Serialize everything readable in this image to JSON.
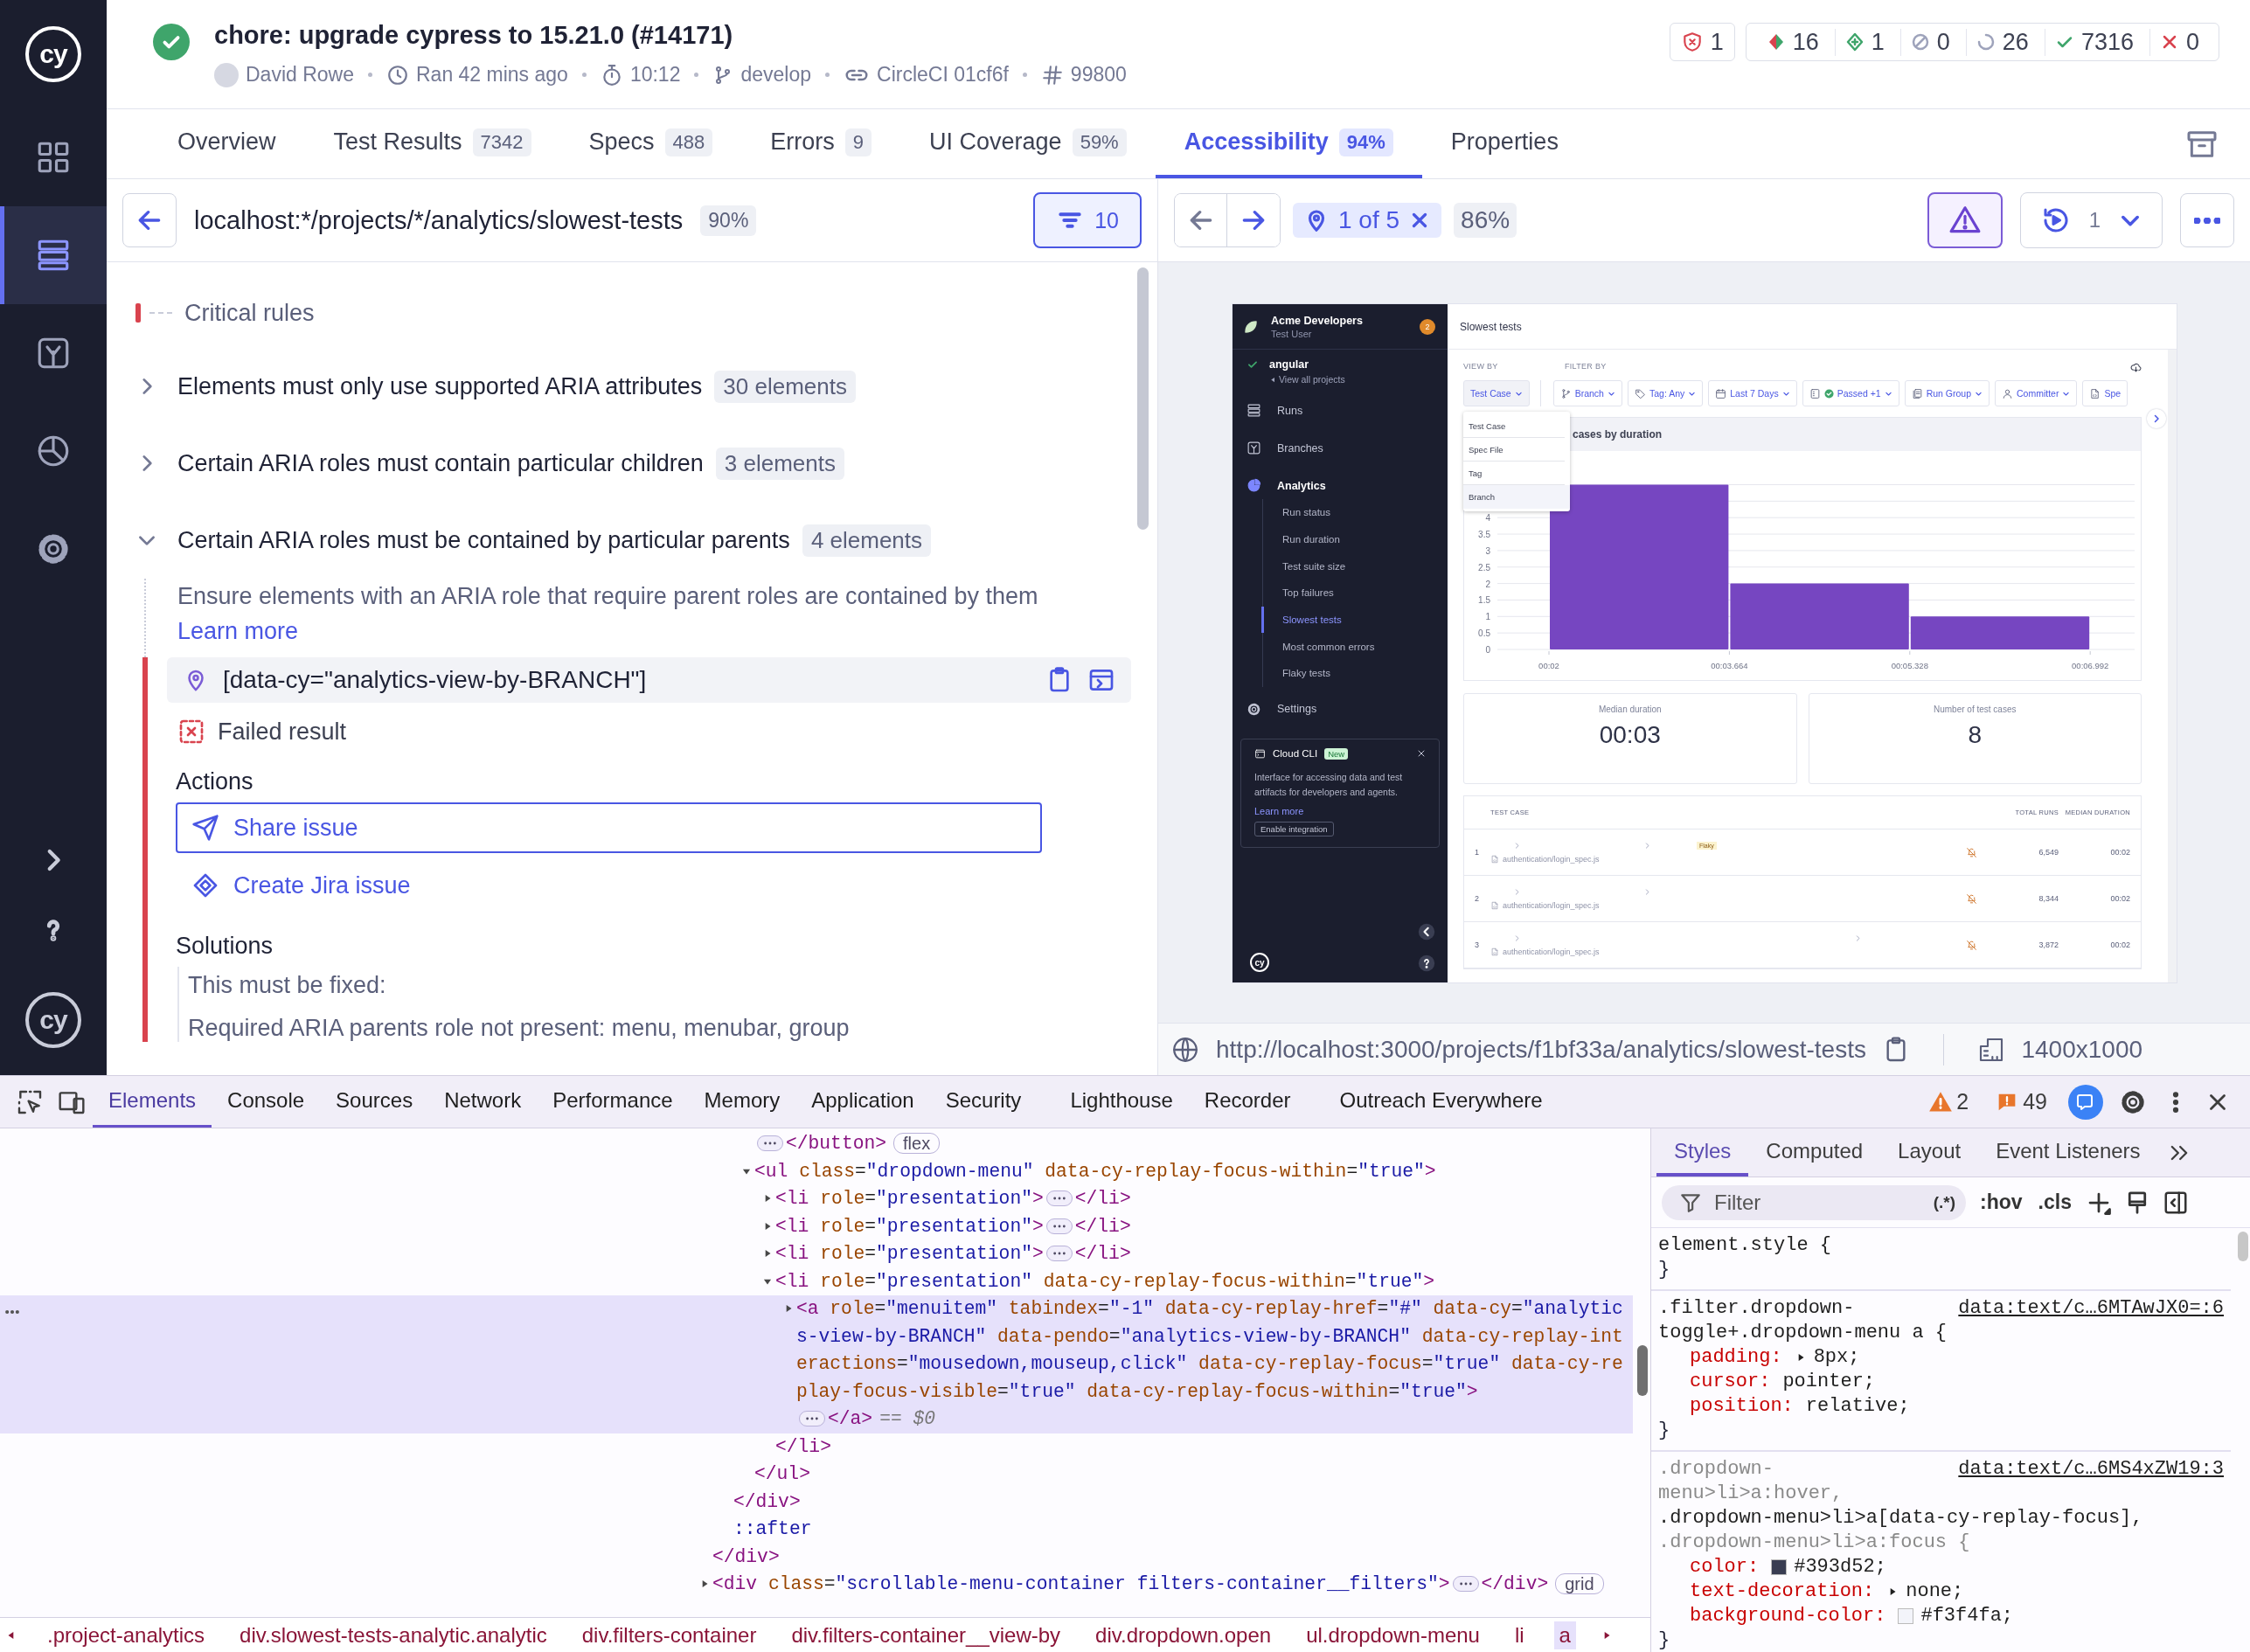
{
  "nav": {
    "logo": "cy",
    "items": [
      {
        "selected": false
      },
      {
        "selected": true
      },
      {
        "selected": false
      },
      {
        "selected": false
      },
      {
        "selected": false
      }
    ],
    "footer_logo": "cy"
  },
  "run": {
    "title": "chore: upgrade cypress to 15.21.0 (#14171)",
    "author": "David Rowe",
    "ran": "Ran 42 mins ago",
    "duration": "10:12",
    "branch": "develop",
    "ci": "CircleCI 01cf6f",
    "number": "99800"
  },
  "flags": {
    "accessibility": "1",
    "counts": [
      {
        "kind": "flaky",
        "value": "16"
      },
      {
        "kind": "new",
        "value": "1"
      },
      {
        "kind": "skipped",
        "value": "0"
      },
      {
        "kind": "pending",
        "value": "26"
      },
      {
        "kind": "passed",
        "value": "7316"
      },
      {
        "kind": "failed",
        "value": "0"
      }
    ]
  },
  "tabs": [
    {
      "label": "Overview",
      "selected": false
    },
    {
      "label": "Test Results",
      "count": "7342",
      "selected": false
    },
    {
      "label": "Specs",
      "count": "488",
      "selected": false
    },
    {
      "label": "Errors",
      "count": "9",
      "selected": false
    },
    {
      "label": "UI Coverage",
      "count": "59%",
      "selected": false
    },
    {
      "label": "Accessibility",
      "count": "94%",
      "selected": true
    },
    {
      "label": "Properties",
      "selected": false
    }
  ],
  "accessibility": {
    "url": "localhost:*/projects/*/analytics/slowest-tests",
    "score": "90%",
    "filter_count": "10",
    "section": "Critical rules",
    "rules": [
      {
        "title": "Elements must only use supported ARIA attributes",
        "count": "30 elements",
        "expanded": false
      },
      {
        "title": "Certain ARIA roles must contain particular children",
        "count": "3 elements",
        "expanded": false
      },
      {
        "title": "Certain ARIA roles must be contained by particular parents",
        "count": "4 elements",
        "expanded": true,
        "description": "Ensure elements with an ARIA role that require parent roles are contained by them",
        "link": "Learn more",
        "selector": "[data-cy=\"analytics-view-by-BRANCH\"]",
        "result": "Failed result",
        "actions_label": "Actions",
        "actions": [
          {
            "label": "Share issue",
            "focused": true
          },
          {
            "label": "Create Jira issue",
            "focused": false
          }
        ],
        "solutions_label": "Solutions",
        "solutions": [
          "This must be fixed:",
          "Required ARIA parents role not present: menu, menubar, group"
        ]
      }
    ]
  },
  "preview": {
    "position": "1 of 5",
    "score": "86%",
    "replay_count": "1",
    "url": "http://localhost:3000/projects/f1bf33a/analytics/slowest-tests",
    "viewport": "1400x1000",
    "app": {
      "org": "Acme Developers",
      "user": "Test User",
      "notifications": "2",
      "project": "angular",
      "back_link": "View all projects",
      "nav": [
        {
          "label": "Runs",
          "selected": false
        },
        {
          "label": "Branches",
          "selected": false
        },
        {
          "label": "Analytics",
          "selected": true,
          "children": [
            {
              "label": "Run status",
              "selected": false
            },
            {
              "label": "Run duration",
              "selected": false
            },
            {
              "label": "Test suite size",
              "selected": false
            },
            {
              "label": "Top failures",
              "selected": false
            },
            {
              "label": "Slowest tests",
              "selected": true
            },
            {
              "label": "Most common errors",
              "selected": false
            },
            {
              "label": "Flaky tests",
              "selected": false
            }
          ]
        },
        {
          "label": "Settings",
          "selected": false
        }
      ],
      "promo": {
        "title": "Cloud CLI",
        "badge": "New",
        "text": "Interface for accessing data and test artifacts for developers and agents.",
        "link": "Learn more",
        "button": "Enable integration"
      },
      "logo": "cy",
      "page_title": "Slowest tests",
      "view_by": {
        "label": "VIEW BY",
        "value": "Test Case",
        "options": [
          {
            "label": "Test Case",
            "highlighted": false
          },
          {
            "label": "Spec File",
            "highlighted": false
          },
          {
            "label": "Tag",
            "highlighted": false
          },
          {
            "label": "Branch",
            "highlighted": true
          }
        ]
      },
      "filter_label": "FILTER BY",
      "filters": [
        "Branch",
        "Tag: Any",
        "Last 7 Days",
        "Passed +1",
        "Run Group",
        "Committer",
        "Spe"
      ],
      "chart_data": {
        "type": "bar",
        "title": "cases by duration",
        "categories": [
          "00:02",
          "00:03.664",
          "00:05.328",
          "00:06.992"
        ],
        "yticks": [
          0,
          0.5,
          1,
          1.5,
          2,
          2.5,
          3,
          3.5,
          4
        ],
        "ylim": [
          0,
          5
        ],
        "grid": true,
        "values": [
          5,
          2,
          1,
          null
        ]
      },
      "metrics": [
        {
          "label": "Median duration",
          "value": "00:03"
        },
        {
          "label": "Number of test cases",
          "value": "8"
        }
      ],
      "table": {
        "columns": [
          "TEST CASE",
          "TOTAL RUNS",
          "MEDIAN DURATION"
        ],
        "rows": [
          {
            "index": "1",
            "spec": "authentication/login_spec.js",
            "tag": "Flaky",
            "total_runs": "6,549",
            "median": "00:02"
          },
          {
            "index": "2",
            "spec": "authentication/login_spec.js",
            "total_runs": "8,344",
            "median": "00:02"
          },
          {
            "index": "3",
            "spec": "authentication/login_spec.js",
            "total_runs": "3,872",
            "median": "00:02"
          }
        ]
      }
    }
  },
  "devtools": {
    "tabs": [
      {
        "label": "Elements",
        "selected": true
      },
      {
        "label": "Console",
        "selected": false
      },
      {
        "label": "Sources",
        "selected": false
      },
      {
        "label": "Network",
        "selected": false
      },
      {
        "label": "Performance",
        "selected": false
      },
      {
        "label": "Memory",
        "selected": false
      },
      {
        "label": "Application",
        "selected": false
      },
      {
        "label": "Security",
        "selected": false
      },
      {
        "label": "Lighthouse",
        "selected": false
      },
      {
        "label": "Recorder",
        "selected": false
      },
      {
        "label": "Outreach Everywhere",
        "selected": false
      }
    ],
    "warnings": "2",
    "issues": "49",
    "tree": [
      {
        "expanded": true,
        "close": "</div>",
        "children": [
          {
            "expanded": true,
            "close": "</div>",
            "children": [
              {
                "expanded": false,
                "close": "</button>",
                "badge": "flex"
              },
              {
                "open": "<ul class=\"dropdown-menu\" data-cy-replay-focus-within=\"true\">",
                "expanded": true,
                "close": "</ul>",
                "children": [
                  {
                    "open": "<li role=\"presentation\">",
                    "expanded": false,
                    "close": "</li>"
                  },
                  {
                    "open": "<li role=\"presentation\">",
                    "expanded": false,
                    "close": "</li>"
                  },
                  {
                    "open": "<li role=\"presentation\">",
                    "expanded": false,
                    "close": "</li>"
                  },
                  {
                    "open": "<li role=\"presentation\" data-cy-replay-focus-within=\"true\">",
                    "expanded": true,
                    "close": "</li>",
                    "children": [
                      {
                        "open": "<a role=\"menuitem\" tabindex=\"-1\" data-cy-replay-href=\"#\" data-cy=\"analytics-view-by-BRANCH\" data-pendo=\"analytics-view-by-BRANCH\" data-cy-replay-interactions=\"mousedown,mouseup,click\" data-cy-replay-focus=\"true\" data-cy-replay-focus-visible=\"true\" data-cy-replay-focus-within=\"true\">",
                        "expanded": false,
                        "close": "</a>",
                        "suffix": "== $0",
                        "selected": true
                      }
                    ]
                  }
                ]
              }
            ]
          },
          {
            "pseudo": "::after"
          }
        ]
      },
      {
        "open": "<div class=\"scrollable-menu-container filters-container__filters\">",
        "expanded": false,
        "close": "</div>",
        "badge": "grid"
      }
    ],
    "breadcrumbs": [
      {
        "label": ".project-analytics",
        "selected": false
      },
      {
        "label": "div.slowest-tests-analytic.analytic",
        "selected": false
      },
      {
        "label": "div.filters-container",
        "selected": false
      },
      {
        "label": "div.filters-container__view-by",
        "selected": false
      },
      {
        "label": "div.dropdown.open",
        "selected": false
      },
      {
        "label": "ul.dropdown-menu",
        "selected": false
      },
      {
        "label": "li",
        "selected": false
      },
      {
        "label": "a",
        "selected": true
      }
    ],
    "side_tabs": [
      {
        "label": "Styles",
        "selected": true
      },
      {
        "label": "Computed",
        "selected": false
      },
      {
        "label": "Layout",
        "selected": false
      },
      {
        "label": "Event Listeners",
        "selected": false
      }
    ],
    "filter_placeholder": "Filter",
    "regex": "(.*)",
    "hov": ":hov",
    "cls": ".cls",
    "rules": [
      {
        "selectors": [
          {
            "text": "element.style {",
            "matched": true
          }
        ],
        "close": "}"
      },
      {
        "selectors": [
          {
            "text": ".filter.dropdown-toggle+.dropdown-menu a {",
            "matched": true
          }
        ],
        "source": "data:text/c…6MTAwJX0=:6",
        "declarations": [
          {
            "property": "padding:",
            "value": "8px;",
            "expandable": true
          },
          {
            "property": "cursor:",
            "value": "pointer;",
            "expandable": false
          },
          {
            "property": "position:",
            "value": "relative;",
            "expandable": false
          }
        ],
        "close": "}"
      },
      {
        "selectors": [
          {
            "text": ".dropdown-menu>li>a:hover,",
            "matched": false
          },
          {
            "text": ".dropdown-menu>li>a[data-cy-replay-focus],",
            "matched": true
          },
          {
            "text": ".dropdown-menu>li>a:focus {",
            "matched": false
          }
        ],
        "source": "data:text/c…6MS4xZW19:3",
        "declarations": [
          {
            "property": "color:",
            "value": "#393d52;",
            "color": "#393d52",
            "expandable": false
          },
          {
            "property": "text-decoration:",
            "value": "none;",
            "expandable": true
          },
          {
            "property": "background-color:",
            "value": "#f3f4fa;",
            "color": "#f3f4fa",
            "expandable": false
          }
        ],
        "close": "}"
      }
    ]
  }
}
